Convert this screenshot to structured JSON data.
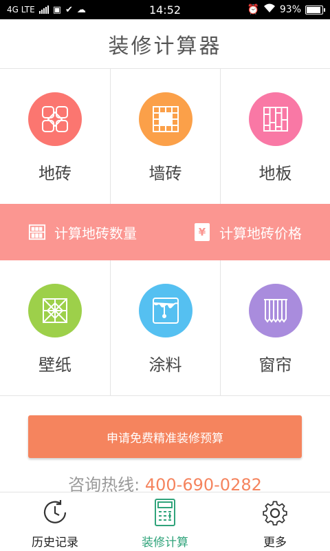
{
  "status_bar": {
    "network": "4G LTE",
    "time": "14:52",
    "battery": "93%"
  },
  "header": {
    "title": "装修计算器"
  },
  "grid_top": [
    {
      "label": "地砖",
      "icon": "floor-tile-icon",
      "color": "#fb7670"
    },
    {
      "label": "墙砖",
      "icon": "wall-tile-icon",
      "color": "#fba049"
    },
    {
      "label": "地板",
      "icon": "wood-floor-icon",
      "color": "#f978a5"
    }
  ],
  "band": {
    "quantity_label": "计算地砖数量",
    "price_label": "计算地砖价格",
    "price_icon_glyph": "¥",
    "color": "#fb9691"
  },
  "grid_bottom": [
    {
      "label": "壁纸",
      "icon": "wallpaper-icon",
      "color": "#9dd04a"
    },
    {
      "label": "涂料",
      "icon": "paint-bucket-icon",
      "color": "#55c0f1"
    },
    {
      "label": "窗帘",
      "icon": "curtain-icon",
      "color": "#a98cdd"
    }
  ],
  "budget_button": {
    "label": "申请免费精准装修预算",
    "color": "#f5845e"
  },
  "hotline": {
    "label": "咨询热线:",
    "phone": "400-690-0282"
  },
  "bottom_nav": {
    "items": [
      {
        "label": "历史记录",
        "icon": "history-icon",
        "active": false
      },
      {
        "label": "装修计算",
        "icon": "calculator-icon",
        "active": true
      },
      {
        "label": "更多",
        "icon": "gear-icon",
        "active": false
      }
    ],
    "active_color": "#2fa37a"
  }
}
